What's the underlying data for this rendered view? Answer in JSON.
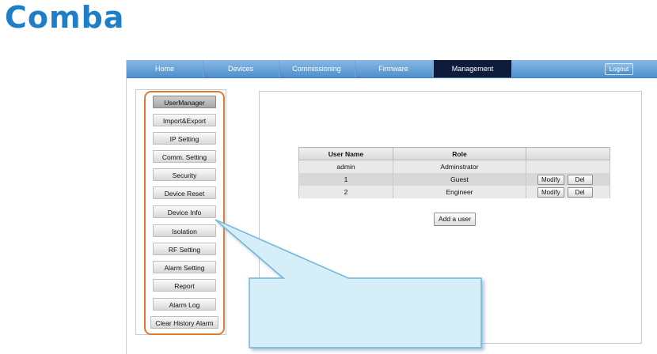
{
  "brand": {
    "logo_text": "Comba",
    "color": "#1e7fc6"
  },
  "topnav": {
    "items": [
      {
        "label": "Home"
      },
      {
        "label": "Devices"
      },
      {
        "label": "Commissioning"
      },
      {
        "label": "Firmware"
      },
      {
        "label": "Management",
        "active": true
      }
    ],
    "logout_label": "Logout"
  },
  "sidebar": {
    "items": [
      {
        "label": "UserManager",
        "active": true
      },
      {
        "label": "Import&Export"
      },
      {
        "label": "IP Setting"
      },
      {
        "label": "Comm. Setting"
      },
      {
        "label": "Security"
      },
      {
        "label": "Device Reset"
      },
      {
        "label": "Device Info"
      },
      {
        "label": "Isolation"
      },
      {
        "label": "RF Setting"
      },
      {
        "label": "Alarm Setting"
      },
      {
        "label": "Report"
      },
      {
        "label": "Alarm Log"
      },
      {
        "label": "Clear History Alarm"
      }
    ],
    "highlight_color": "#e07b2e"
  },
  "user_table": {
    "headers": [
      "User Name",
      "Role",
      ""
    ],
    "rows": [
      {
        "name": "admin",
        "role": "Adminstrator"
      },
      {
        "name": "1",
        "role": "Guest",
        "modify_label": "Modify",
        "del_label": "Del"
      },
      {
        "name": "2",
        "role": "Engineer",
        "modify_label": "Modify",
        "del_label": "Del"
      }
    ]
  },
  "add_user_label": "Add a user",
  "callout": {
    "fill": "#d6eef8",
    "stroke": "#6fb6dc"
  }
}
